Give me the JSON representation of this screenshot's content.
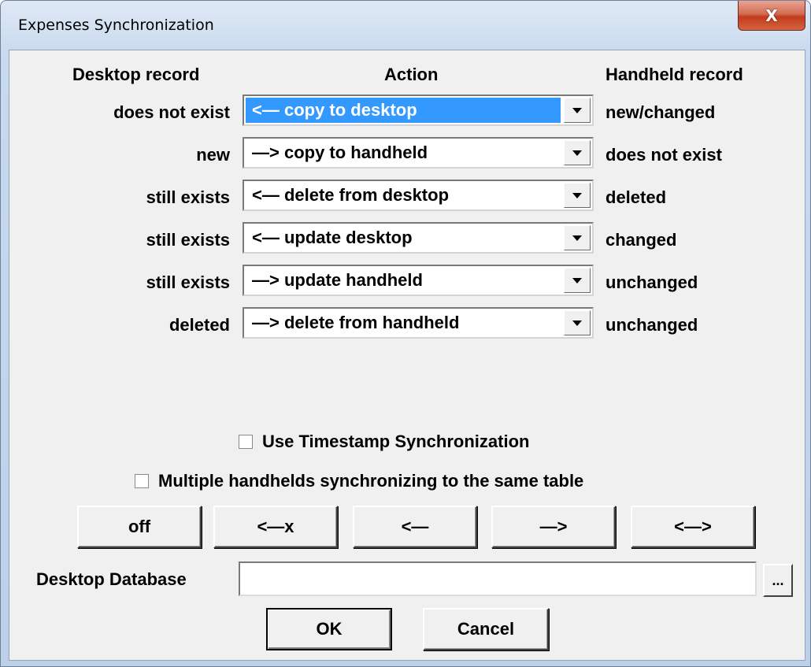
{
  "window": {
    "title": "Expenses Synchronization",
    "close_glyph": "X"
  },
  "headers": {
    "desktop": "Desktop record",
    "action": "Action",
    "handheld": "Handheld record"
  },
  "rows": [
    {
      "desktop": "does not exist",
      "action": "<— copy to desktop",
      "handheld": "new/changed",
      "selected": true
    },
    {
      "desktop": "new",
      "action": "—> copy to handheld",
      "handheld": "does not exist",
      "selected": false
    },
    {
      "desktop": "still exists",
      "action": "<— delete from desktop",
      "handheld": "deleted",
      "selected": false
    },
    {
      "desktop": "still exists",
      "action": "<— update desktop",
      "handheld": "changed",
      "selected": false
    },
    {
      "desktop": "still exists",
      "action": "—> update handheld",
      "handheld": "unchanged",
      "selected": false
    },
    {
      "desktop": "deleted",
      "action": "—> delete from handheld",
      "handheld": "unchanged",
      "selected": false
    }
  ],
  "options": {
    "timestamp_label": "Use Timestamp Synchronization",
    "timestamp_checked": false,
    "multiple_label": "Multiple handhelds synchronizing to the same table",
    "multiple_checked": false
  },
  "mode_buttons": [
    "off",
    "<—x",
    "<—",
    "—>",
    "<—>"
  ],
  "database": {
    "label": "Desktop Database",
    "value": "",
    "browse_label": "..."
  },
  "footer": {
    "ok_label": "OK",
    "cancel_label": "Cancel"
  },
  "colors": {
    "selection": "#3399ff",
    "dialog_bg": "#f0f0f0",
    "close_button": "#c23b1d"
  }
}
